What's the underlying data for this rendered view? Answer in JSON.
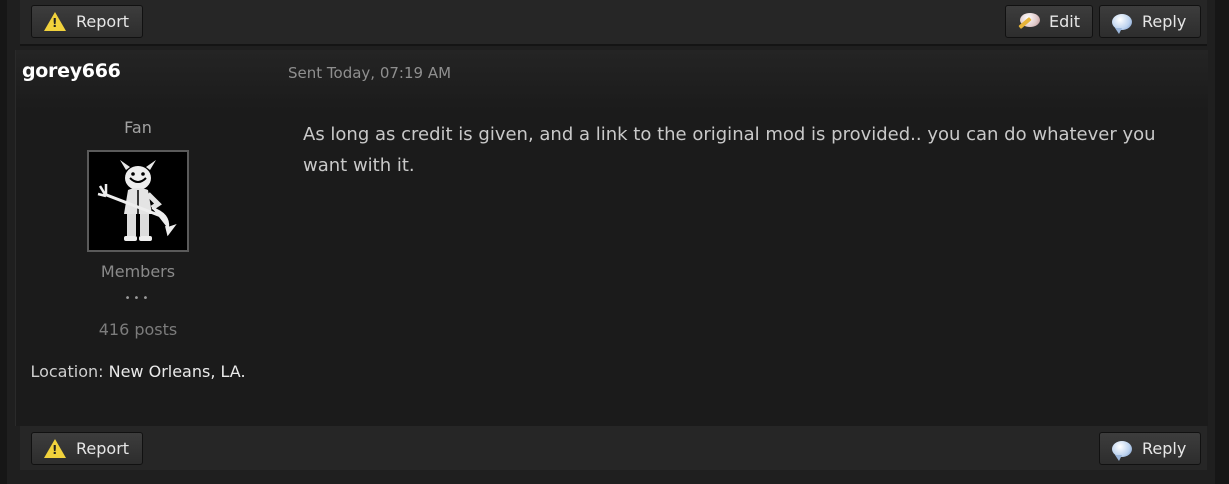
{
  "top_bar": {
    "report_label": "Report",
    "edit_label": "Edit",
    "reply_label": "Reply"
  },
  "post": {
    "username": "gorey666",
    "sent": "Sent Today, 07:19 AM",
    "user_title": "Fan",
    "group": "Members",
    "pips": "•••",
    "post_count": "416 posts",
    "location_label": "Location:",
    "location_value": "New Orleans, LA.",
    "message": "As long as credit is given, and a link to the original mod is provided.. you can do whatever you want with it."
  },
  "bottom_bar": {
    "report_label": "Report",
    "reply_label": "Reply"
  },
  "icons": {
    "report": "warning-triangle-icon",
    "edit": "edit-bubble-icon",
    "reply": "speech-bubble-icon"
  },
  "colors": {
    "warning": "#f1d23c",
    "background": "#1b1b1b"
  }
}
